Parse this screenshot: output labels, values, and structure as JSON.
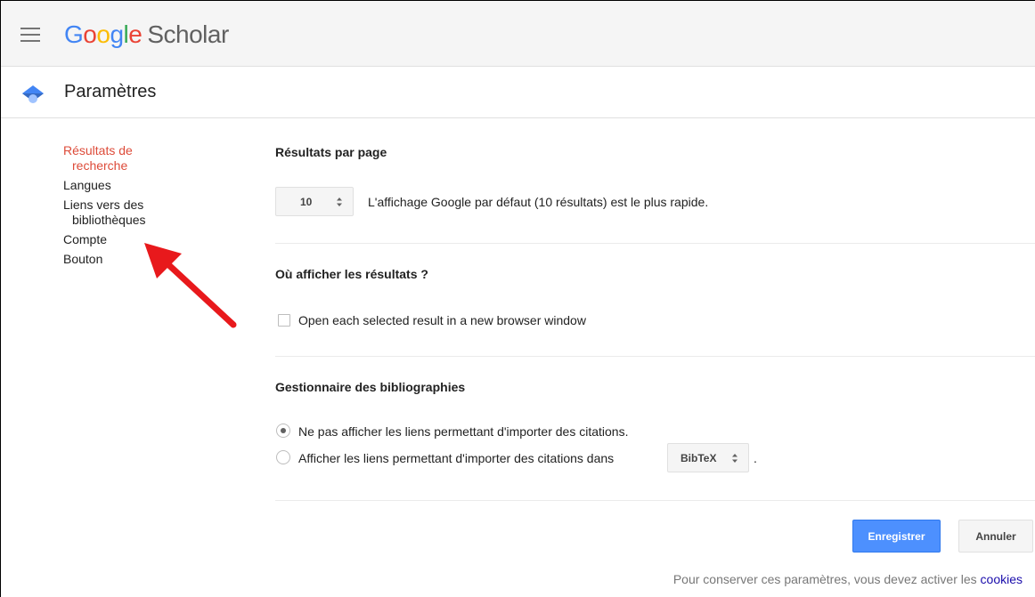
{
  "app": {
    "logo_google": [
      "G",
      "o",
      "o",
      "g",
      "l",
      "e"
    ],
    "logo_scholar": "Scholar"
  },
  "page": {
    "title": "Paramètres"
  },
  "nav": {
    "items": [
      {
        "line1": "Résultats de",
        "line2": "recherche",
        "active": true
      },
      {
        "line1": "Langues",
        "line2": ""
      },
      {
        "line1": "Liens vers des",
        "line2": "bibliothèques"
      },
      {
        "line1": "Compte",
        "line2": ""
      },
      {
        "line1": "Bouton",
        "line2": ""
      }
    ]
  },
  "results_per_page": {
    "title": "Résultats par page",
    "selected": "10",
    "description": "L'affichage Google par défaut (10 résultats) est le plus rapide."
  },
  "where_results": {
    "title": "Où afficher les résultats ?",
    "checkbox_label": "Open each selected result in a new browser window",
    "checked": false
  },
  "bibliography": {
    "title": "Gestionnaire des bibliographies",
    "option_none": "Ne pas afficher les liens permettant d'importer des citations.",
    "option_show": "Afficher les liens permettant d'importer des citations dans",
    "format_selected": "BibTeX",
    "trailing": ".",
    "selected_option": "none"
  },
  "actions": {
    "save_label": "Enregistrer",
    "cancel_label": "Annuler"
  },
  "footer": {
    "text": "Pour conserver ces paramètres, vous devez activer les",
    "link": "cookies"
  },
  "colors": {
    "accent_active": "#dd4b39",
    "primary_button": "#4d90fe",
    "annotation_arrow": "#e8191c"
  }
}
